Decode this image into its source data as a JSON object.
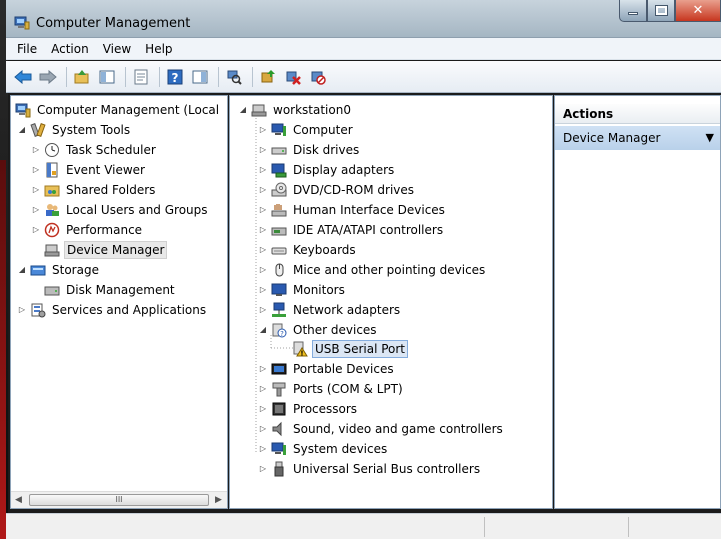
{
  "window": {
    "title": "Computer Management"
  },
  "menu": [
    "File",
    "Action",
    "View",
    "Help"
  ],
  "toolbar": [
    "back-icon",
    "forward-icon",
    "up-folder-icon",
    "show-hide-tree-icon",
    "properties-icon",
    "help-icon",
    "show-hide-action-pane-icon",
    "scan-hardware-icon",
    "update-driver-icon",
    "uninstall-icon",
    "disable-device-icon"
  ],
  "left_tree": [
    {
      "label": "Computer Management (Local",
      "level": 0,
      "expander": "",
      "icon": "computer-management-icon"
    },
    {
      "label": "System Tools",
      "level": 1,
      "expander": "open",
      "icon": "system-tools-icon"
    },
    {
      "label": "Task Scheduler",
      "level": 2,
      "expander": "closed",
      "icon": "clock-icon"
    },
    {
      "label": "Event Viewer",
      "level": 2,
      "expander": "closed",
      "icon": "event-viewer-icon"
    },
    {
      "label": "Shared Folders",
      "level": 2,
      "expander": "closed",
      "icon": "shared-folder-icon"
    },
    {
      "label": "Local Users and Groups",
      "level": 2,
      "expander": "closed",
      "icon": "users-icon"
    },
    {
      "label": "Performance",
      "level": 2,
      "expander": "closed",
      "icon": "performance-icon"
    },
    {
      "label": "Device Manager",
      "level": 2,
      "expander": "",
      "icon": "device-manager-icon",
      "selected": true
    },
    {
      "label": "Storage",
      "level": 1,
      "expander": "open",
      "icon": "storage-icon"
    },
    {
      "label": "Disk Management",
      "level": 2,
      "expander": "",
      "icon": "disk-icon"
    },
    {
      "label": "Services and Applications",
      "level": 1,
      "expander": "closed",
      "icon": "services-icon"
    }
  ],
  "scrollbar": {
    "grip": "III"
  },
  "device_tree": [
    {
      "label": "workstation0",
      "level": 0,
      "expander": "open",
      "icon": "workstation-icon"
    },
    {
      "label": "Computer",
      "level": 1,
      "expander": "closed",
      "icon": "computer-icon"
    },
    {
      "label": "Disk drives",
      "level": 1,
      "expander": "closed",
      "icon": "disk-drive-icon"
    },
    {
      "label": "Display adapters",
      "level": 1,
      "expander": "closed",
      "icon": "display-adapter-icon"
    },
    {
      "label": "DVD/CD-ROM drives",
      "level": 1,
      "expander": "closed",
      "icon": "dvd-drive-icon"
    },
    {
      "label": "Human Interface Devices",
      "level": 1,
      "expander": "closed",
      "icon": "hid-icon"
    },
    {
      "label": "IDE ATA/ATAPI controllers",
      "level": 1,
      "expander": "closed",
      "icon": "ide-controller-icon"
    },
    {
      "label": "Keyboards",
      "level": 1,
      "expander": "closed",
      "icon": "keyboard-icon"
    },
    {
      "label": "Mice and other pointing devices",
      "level": 1,
      "expander": "closed",
      "icon": "mouse-icon"
    },
    {
      "label": "Monitors",
      "level": 1,
      "expander": "closed",
      "icon": "monitor-icon"
    },
    {
      "label": "Network adapters",
      "level": 1,
      "expander": "closed",
      "icon": "network-adapter-icon"
    },
    {
      "label": "Other devices",
      "level": 1,
      "expander": "open",
      "icon": "unknown-device-icon"
    },
    {
      "label": "USB Serial Port",
      "level": 2,
      "expander": "",
      "icon": "warning-device-icon",
      "selected": true
    },
    {
      "label": "Portable Devices",
      "level": 1,
      "expander": "closed",
      "icon": "portable-device-icon"
    },
    {
      "label": "Ports (COM & LPT)",
      "level": 1,
      "expander": "closed",
      "icon": "port-icon"
    },
    {
      "label": "Processors",
      "level": 1,
      "expander": "closed",
      "icon": "processor-icon"
    },
    {
      "label": "Sound, video and game controllers",
      "level": 1,
      "expander": "closed",
      "icon": "speaker-icon"
    },
    {
      "label": "System devices",
      "level": 1,
      "expander": "closed",
      "icon": "system-device-icon"
    },
    {
      "label": "Universal Serial Bus controllers",
      "level": 1,
      "expander": "closed",
      "icon": "usb-icon"
    }
  ],
  "actions": {
    "header": "Actions",
    "item": "Device Manager"
  }
}
